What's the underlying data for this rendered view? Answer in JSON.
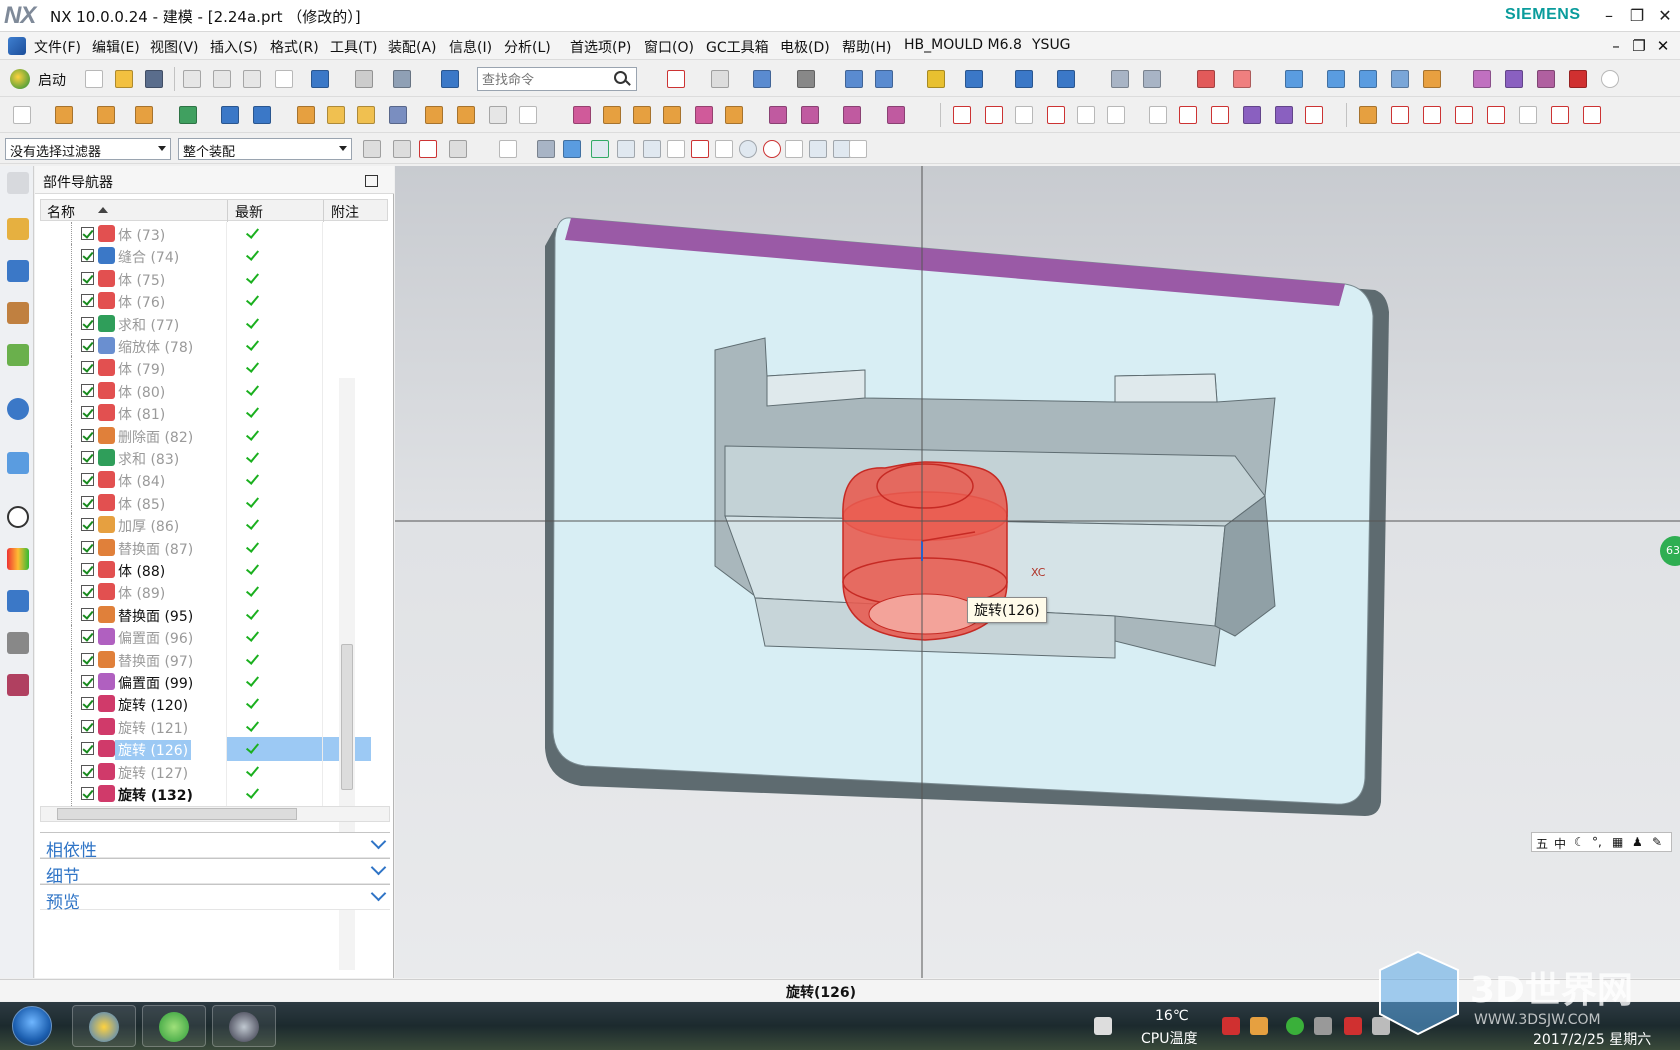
{
  "window": {
    "logo": "NX",
    "title": "NX 10.0.0.24 - 建模 - [2.24a.prt （修改的）]",
    "brand": "SIEMENS",
    "minimize": "–",
    "restore": "❐",
    "close": "✕"
  },
  "menu": {
    "items": [
      "文件(F)",
      "编辑(E)",
      "视图(V)",
      "插入(S)",
      "格式(R)",
      "工具(T)",
      "装配(A)",
      "信息(I)",
      "分析(L)",
      "首选项(P)",
      "窗口(O)",
      "GC工具箱",
      "电极(D)",
      "帮助(H)",
      "HB_MOULD M6.8",
      "YSUG"
    ],
    "doc_minimize": "–",
    "doc_restore": "❐",
    "doc_close": "✕"
  },
  "toolbar": {
    "start_label": "启动",
    "search_placeholder": "查找命令",
    "filter_select": "没有选择过滤器",
    "scope_select": "整个装配"
  },
  "navigator": {
    "title": "部件导航器",
    "columns": {
      "name": "名称",
      "latest": "最新",
      "comment": "附注"
    },
    "rows": [
      {
        "label": "体 (73)",
        "state": "dim",
        "icon": "body-icon"
      },
      {
        "label": "缝合 (74)",
        "state": "dim",
        "icon": "sew-icon"
      },
      {
        "label": "体 (75)",
        "state": "dim",
        "icon": "body-icon"
      },
      {
        "label": "体 (76)",
        "state": "dim",
        "icon": "body-icon"
      },
      {
        "label": "求和 (77)",
        "state": "dim",
        "icon": "unite-icon"
      },
      {
        "label": "缩放体 (78)",
        "state": "dim",
        "icon": "scale-body-icon"
      },
      {
        "label": "体 (79)",
        "state": "dim",
        "icon": "body-icon"
      },
      {
        "label": "体 (80)",
        "state": "dim",
        "icon": "body-icon"
      },
      {
        "label": "体 (81)",
        "state": "dim",
        "icon": "body-icon"
      },
      {
        "label": "删除面 (82)",
        "state": "dim",
        "icon": "delete-face-icon"
      },
      {
        "label": "求和 (83)",
        "state": "dim",
        "icon": "unite-icon"
      },
      {
        "label": "体 (84)",
        "state": "dim",
        "icon": "body-icon"
      },
      {
        "label": "体 (85)",
        "state": "dim",
        "icon": "body-icon"
      },
      {
        "label": "加厚 (86)",
        "state": "dim",
        "icon": "thicken-icon"
      },
      {
        "label": "替换面 (87)",
        "state": "dim",
        "icon": "replace-face-icon"
      },
      {
        "label": "体 (88)",
        "state": "normal",
        "icon": "body-icon"
      },
      {
        "label": "体 (89)",
        "state": "dim",
        "icon": "body-icon"
      },
      {
        "label": "替换面 (95)",
        "state": "normal",
        "icon": "replace-face-icon"
      },
      {
        "label": "偏置面 (96)",
        "state": "dim",
        "icon": "offset-face-icon"
      },
      {
        "label": "替换面 (97)",
        "state": "dim",
        "icon": "replace-face-icon"
      },
      {
        "label": "偏置面 (99)",
        "state": "normal",
        "icon": "offset-face-icon"
      },
      {
        "label": "旋转 (120)",
        "state": "normal",
        "icon": "revolve-icon"
      },
      {
        "label": "旋转 (121)",
        "state": "dim",
        "icon": "revolve-icon"
      },
      {
        "label": "旋转 (126)",
        "state": "selected",
        "icon": "revolve-icon"
      },
      {
        "label": "旋转 (127)",
        "state": "dim",
        "icon": "revolve-icon"
      },
      {
        "label": "旋转 (132)",
        "state": "bold",
        "icon": "revolve-icon"
      }
    ],
    "sections": [
      "相依性",
      "细节",
      "预览"
    ]
  },
  "viewport": {
    "tooltip": "旋转(126)",
    "axis_label": "XC",
    "ime": [
      "五",
      "中",
      "☾",
      "°,",
      "▦",
      "♟",
      "✎"
    ],
    "badge": "63"
  },
  "status": {
    "text": "旋转(126)"
  },
  "taskbar": {
    "temperature": "16℃",
    "cpu_label": "CPU温度",
    "date": "2017/2/25 星期六"
  },
  "watermark": {
    "brand": "3D世界网",
    "url": "WWW.3DSJW.COM"
  },
  "colors": {
    "accent": "#2f74c6",
    "selection": "#9cc9f4",
    "check": "#1bb01f",
    "plate_face": "#d8eef4",
    "plate_edge": "#5e6b70",
    "band": "#9a5aa6",
    "solid": "#e85a4f",
    "brand": "#0a9c9c"
  }
}
